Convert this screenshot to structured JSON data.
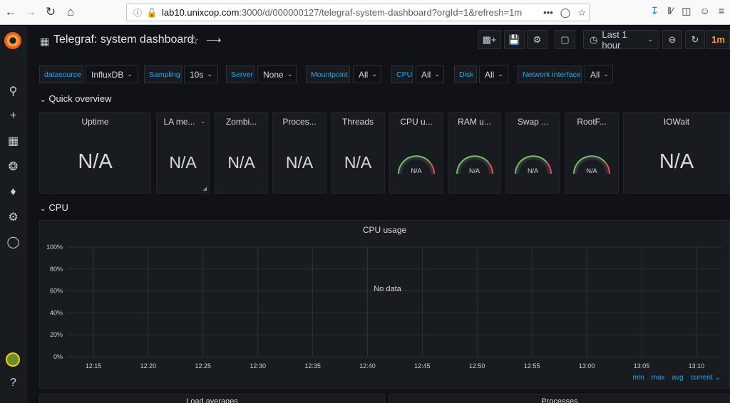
{
  "browser": {
    "url_host": "lab10.unixcop.com",
    "url_rest": ":3000/d/000000127/telegraf-system-dashboard?orgId=1&refresh=1m",
    "more_glyph": "•••"
  },
  "dashboard": {
    "title": "Telegraf: system dashboard",
    "time_range": "Last 1 hour",
    "refresh_interval": "1m"
  },
  "variables": [
    {
      "label": "datasource",
      "value": "InfluxDB"
    },
    {
      "label": "Sampling",
      "value": "10s"
    },
    {
      "label": "Server",
      "value": "None"
    },
    {
      "label": "Mountpoint",
      "value": "All"
    },
    {
      "label": "CPU",
      "value": "All"
    },
    {
      "label": "Disk",
      "value": "All"
    },
    {
      "label": "Network interface",
      "value": "All"
    }
  ],
  "rows": {
    "quick_overview": "Quick overview",
    "cpu": "CPU"
  },
  "stat_panels": [
    {
      "title": "Uptime",
      "value": "N/A"
    },
    {
      "title": "LA me...",
      "value": "N/A"
    },
    {
      "title": "Zombi...",
      "value": "N/A"
    },
    {
      "title": "Proces...",
      "value": "N/A"
    },
    {
      "title": "Threads",
      "value": "N/A"
    },
    {
      "title": "CPU u...",
      "value": "N/A"
    },
    {
      "title": "RAM u...",
      "value": "N/A"
    },
    {
      "title": "Swap ...",
      "value": "N/A"
    },
    {
      "title": "RootF...",
      "value": "N/A"
    },
    {
      "title": "IOWait",
      "value": "N/A"
    }
  ],
  "gauge_colors": {
    "green": "#73bf69",
    "red": "#f2495c",
    "track": "#2c3235"
  },
  "cpu_panel": {
    "title": "CPU usage",
    "no_data": "No data",
    "legend": {
      "min": "min",
      "max": "max",
      "avg": "avg",
      "current": "current"
    }
  },
  "chart_data": {
    "type": "line",
    "title": "CPU usage",
    "xlabel": "",
    "ylabel": "",
    "x_ticks": [
      "12:15",
      "12:20",
      "12:25",
      "12:30",
      "12:35",
      "12:40",
      "12:45",
      "12:50",
      "12:55",
      "13:00",
      "13:05",
      "13:10"
    ],
    "y_ticks": [
      "0%",
      "20%",
      "40%",
      "60%",
      "80%",
      "100%"
    ],
    "ylim": [
      0,
      100
    ],
    "series": [],
    "grid": true,
    "annotation": "No data"
  },
  "bottom_panels": [
    {
      "title": "Load averages"
    },
    {
      "title": "Processes"
    }
  ]
}
